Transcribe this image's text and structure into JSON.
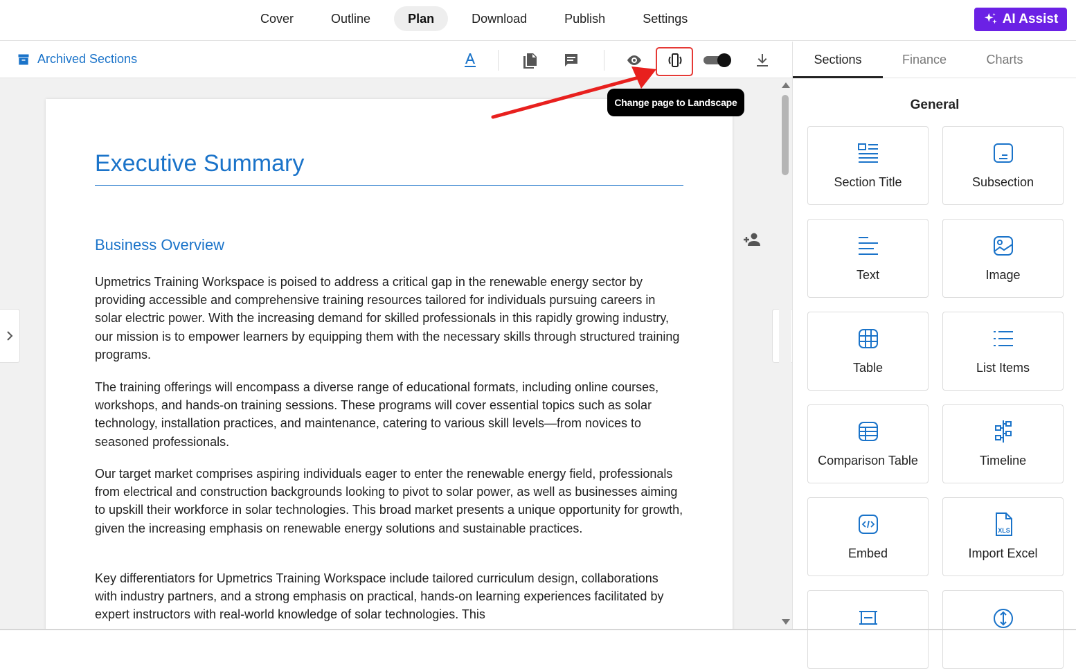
{
  "topnav": {
    "tabs": [
      {
        "label": "Cover"
      },
      {
        "label": "Outline"
      },
      {
        "label": "Plan"
      },
      {
        "label": "Download"
      },
      {
        "label": "Publish"
      },
      {
        "label": "Settings"
      }
    ],
    "active_tab": "Plan",
    "ai_assist_label": "AI Assist",
    "ai_assist_color": "#6b21e5"
  },
  "toolbar": {
    "archived_label": "Archived Sections",
    "tools": [
      "text-style-icon",
      "pages-icon",
      "comment-icon",
      "preview-eye-icon",
      "page-orientation-icon",
      "toggle-switch",
      "download-icon"
    ],
    "tooltip": "Change page to Landscape"
  },
  "document": {
    "title": "Executive Summary",
    "subtitle": "Business Overview",
    "paragraphs": [
      "Upmetrics Training Workspace is poised to address a critical gap in the renewable energy sector by providing accessible and comprehensive training resources tailored for individuals pursuing careers in solar electric power. With the increasing demand for skilled professionals in this rapidly growing industry, our mission is to empower learners by equipping them with the necessary skills through structured training programs.",
      "The training offerings will encompass a diverse range of educational formats, including online courses, workshops, and hands-on training sessions. These programs will cover essential topics such as solar technology, installation practices, and maintenance, catering to various skill levels—from novices to seasoned professionals.",
      "Our target market comprises aspiring individuals eager to enter the renewable energy field, professionals from electrical and construction backgrounds looking to pivot to solar power, as well as businesses aiming to upskill their workforce in solar technologies. This broad market presents a unique opportunity for growth, given the increasing emphasis on renewable energy solutions and sustainable practices.",
      "Key differentiators for Upmetrics Training Workspace include tailored curriculum design, collaborations with industry partners, and a strong emphasis on practical, hands-on learning experiences facilitated by expert instructors with real-world knowledge of solar technologies. This"
    ],
    "accent_color": "#1a73c9"
  },
  "right_panel": {
    "tabs": [
      {
        "label": "Sections"
      },
      {
        "label": "Finance"
      },
      {
        "label": "Charts"
      }
    ],
    "active_tab": "Sections",
    "group_title": "General",
    "cards": [
      {
        "label": "Section Title",
        "icon": "section-title-icon"
      },
      {
        "label": "Subsection",
        "icon": "subsection-icon"
      },
      {
        "label": "Text",
        "icon": "text-icon"
      },
      {
        "label": "Image",
        "icon": "image-icon"
      },
      {
        "label": "Table",
        "icon": "table-icon"
      },
      {
        "label": "List Items",
        "icon": "list-icon"
      },
      {
        "label": "Comparison Table",
        "icon": "comparison-table-icon"
      },
      {
        "label": "Timeline",
        "icon": "timeline-icon"
      },
      {
        "label": "Embed",
        "icon": "embed-icon"
      },
      {
        "label": "Import Excel",
        "icon": "excel-icon"
      },
      {
        "label": "",
        "icon": "spacer-icon"
      },
      {
        "label": "",
        "icon": "vertical-space-icon"
      }
    ]
  }
}
